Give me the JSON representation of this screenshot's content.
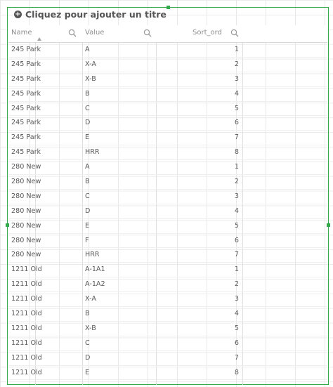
{
  "title": {
    "icon": "plus-circle-icon",
    "text": "Cliquez pour ajouter un titre"
  },
  "columns": [
    {
      "label": "Name",
      "sorted": "ascending",
      "search_icon": "search-icon"
    },
    {
      "label": "Value",
      "search_icon": "search-icon"
    },
    {
      "label": "Sort_ord",
      "search_icon": "search-icon"
    }
  ],
  "rows": [
    {
      "name": "245 Park",
      "value": "A",
      "sort": "1"
    },
    {
      "name": "245 Park",
      "value": "X-A",
      "sort": "2"
    },
    {
      "name": "245 Park",
      "value": "X-B",
      "sort": "3"
    },
    {
      "name": "245 Park",
      "value": "B",
      "sort": "4"
    },
    {
      "name": "245 Park",
      "value": "C",
      "sort": "5"
    },
    {
      "name": "245 Park",
      "value": "D",
      "sort": "6"
    },
    {
      "name": "245 Park",
      "value": "E",
      "sort": "7"
    },
    {
      "name": "245 Park",
      "value": "HRR",
      "sort": "8"
    },
    {
      "name": "280 New",
      "value": "A",
      "sort": "1"
    },
    {
      "name": "280 New",
      "value": "B",
      "sort": "2"
    },
    {
      "name": "280 New",
      "value": "C",
      "sort": "3"
    },
    {
      "name": "280 New",
      "value": "D",
      "sort": "4"
    },
    {
      "name": "280 New",
      "value": "E",
      "sort": "5"
    },
    {
      "name": "280 New",
      "value": "F",
      "sort": "6"
    },
    {
      "name": "280 New",
      "value": "HRR",
      "sort": "7"
    },
    {
      "name": "1211 Old",
      "value": "A-1A1",
      "sort": "1"
    },
    {
      "name": "1211 Old",
      "value": "A-1A2",
      "sort": "2"
    },
    {
      "name": "1211 Old",
      "value": "X-A",
      "sort": "3"
    },
    {
      "name": "1211 Old",
      "value": "B",
      "sort": "4"
    },
    {
      "name": "1211 Old",
      "value": "X-B",
      "sort": "5"
    },
    {
      "name": "1211 Old",
      "value": "C",
      "sort": "6"
    },
    {
      "name": "1211 Old",
      "value": "D",
      "sort": "7"
    },
    {
      "name": "1211 Old",
      "value": "E",
      "sort": "8"
    }
  ],
  "colors": {
    "selection_frame": "#36a94a",
    "text": "#595959",
    "header_text": "#8e8e8e"
  }
}
